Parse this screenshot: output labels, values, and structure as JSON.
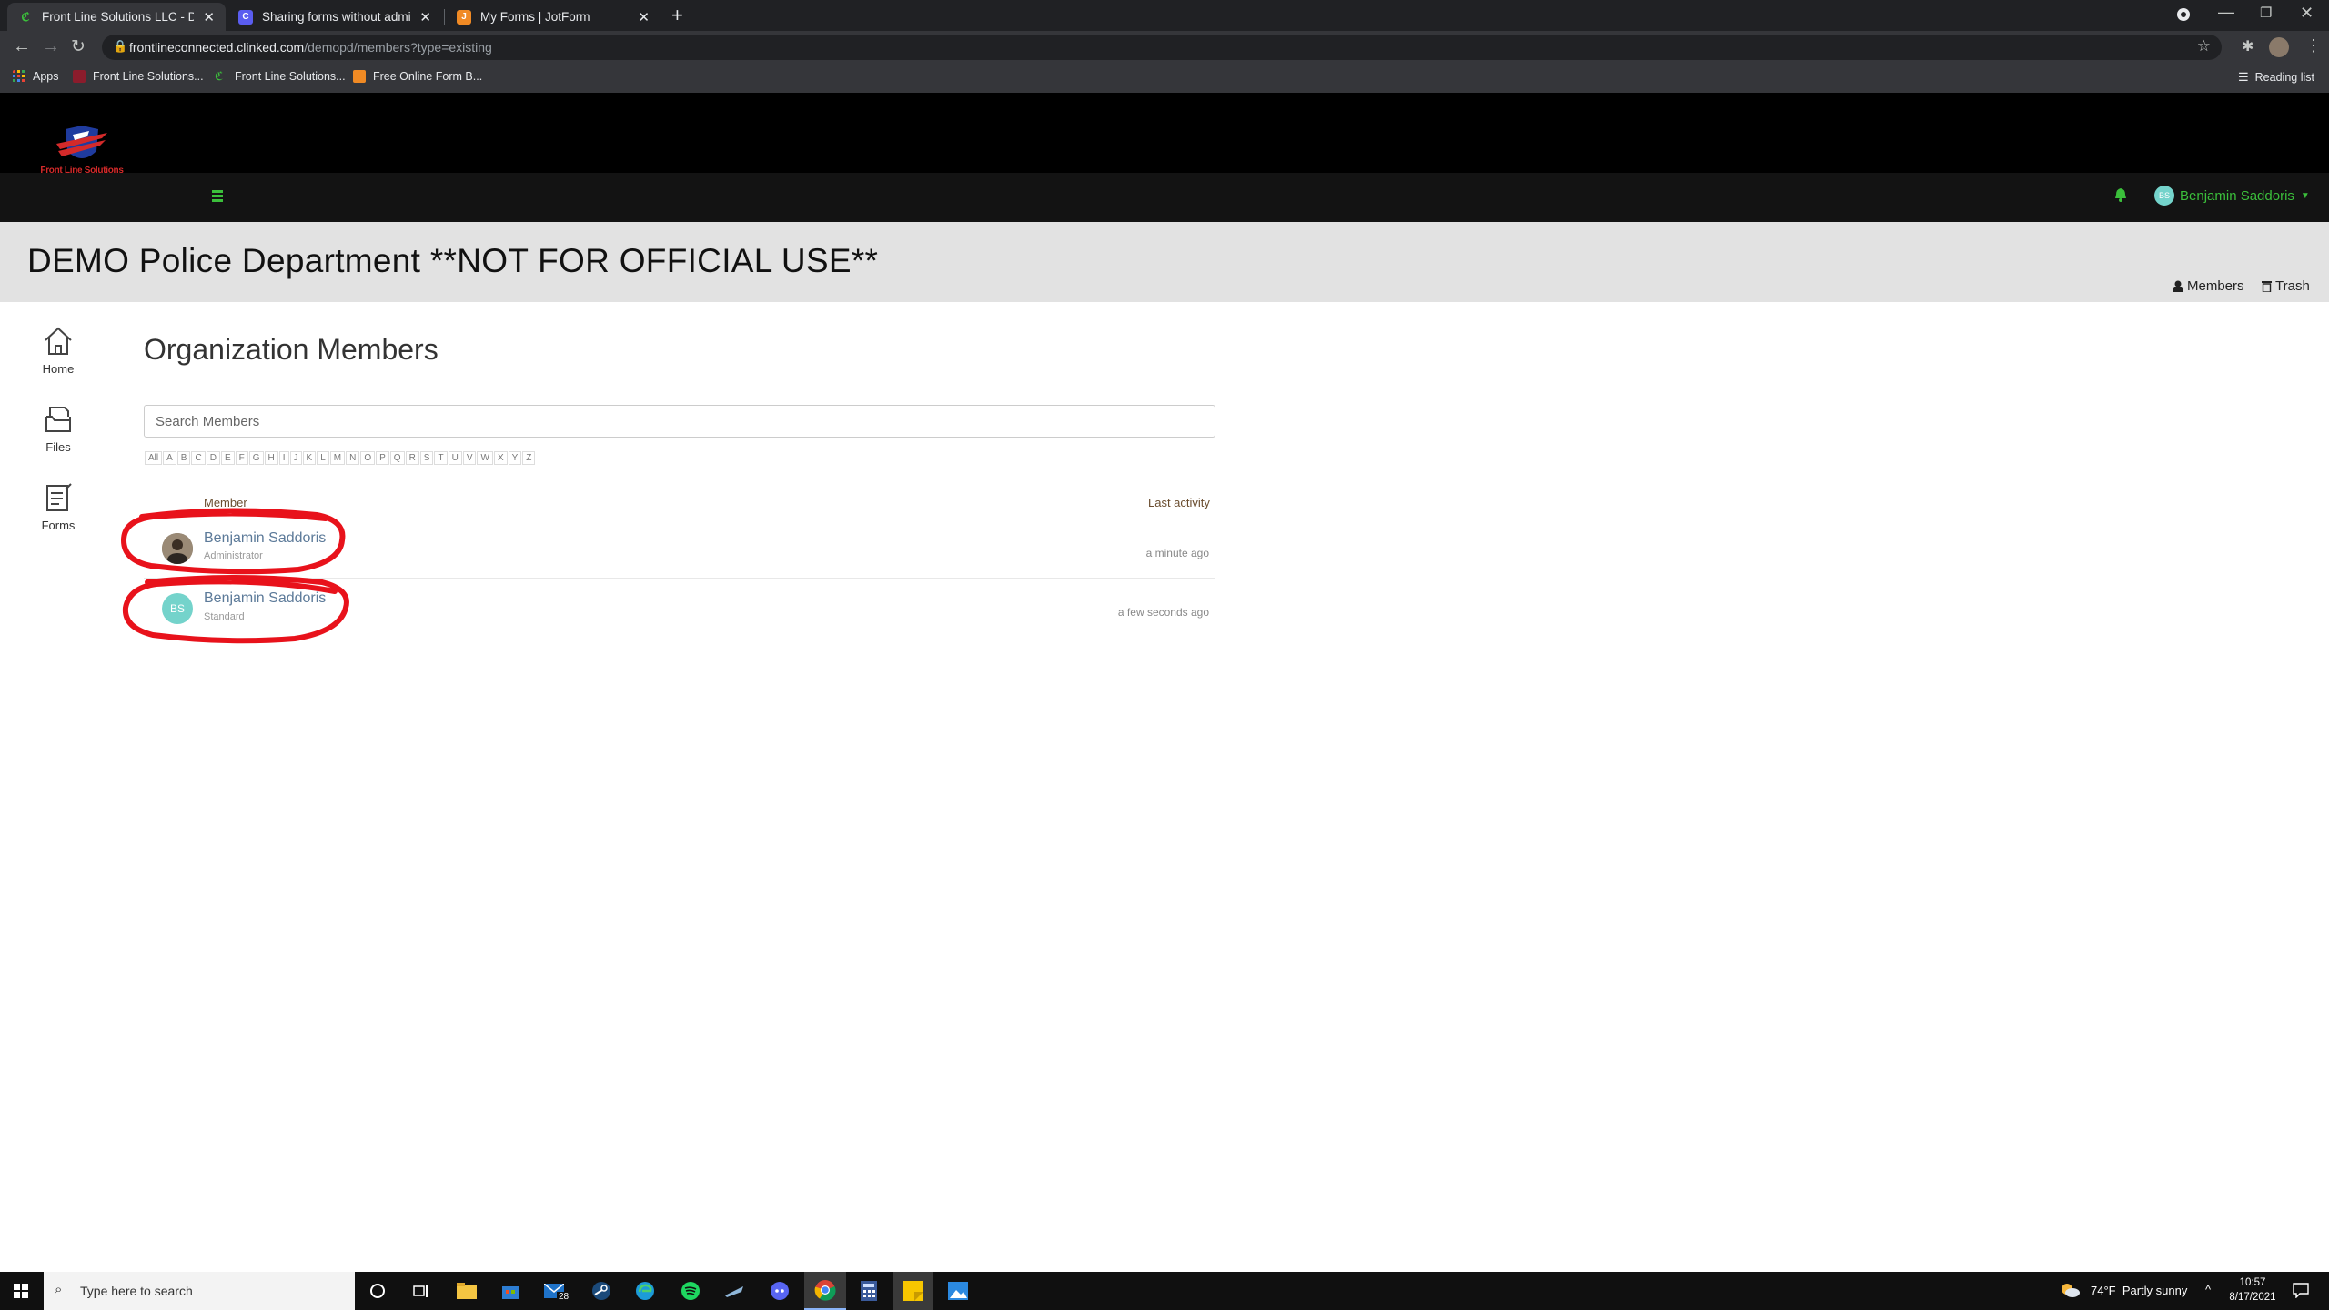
{
  "browser": {
    "tabs": [
      {
        "title": "Front Line Solutions LLC - DEMO",
        "close": "✕"
      },
      {
        "title": "Sharing forms without admin rig",
        "close": "✕"
      },
      {
        "title": "My Forms | JotForm",
        "close": "✕"
      }
    ],
    "new_tab": "+",
    "url_host": "frontlineconnected.clinked.com",
    "url_path": "/demopd/members?type=existing",
    "bookmarks": [
      "Apps",
      "Front Line Solutions...",
      "Front Line Solutions...",
      "Free Online Form B..."
    ],
    "reading_list": "Reading list"
  },
  "site": {
    "logo_text": "Front Line Solutions",
    "user_name": "Benjamin Saddoris",
    "user_initials": "BS",
    "banner_title": "DEMO Police Department **NOT FOR OFFICIAL USE**",
    "members_btn": "Members",
    "trash_btn": "Trash"
  },
  "leftnav": [
    {
      "label": "Home",
      "icon": "home-icon"
    },
    {
      "label": "Files",
      "icon": "files-icon"
    },
    {
      "label": "Forms",
      "icon": "forms-icon"
    }
  ],
  "main": {
    "title": "Organization Members",
    "search_placeholder": "Search Members",
    "letters": [
      "All",
      "A",
      "B",
      "C",
      "D",
      "E",
      "F",
      "G",
      "H",
      "I",
      "J",
      "K",
      "L",
      "M",
      "N",
      "O",
      "P",
      "Q",
      "R",
      "S",
      "T",
      "U",
      "V",
      "W",
      "X",
      "Y",
      "Z"
    ],
    "col_member": "Member",
    "col_activity": "Last activity",
    "members": [
      {
        "name": "Benjamin Saddoris",
        "role": "Administrator",
        "activity": "a minute ago",
        "initials": ""
      },
      {
        "name": "Benjamin Saddoris",
        "role": "Standard",
        "activity": "a few seconds ago",
        "initials": "BS"
      }
    ]
  },
  "taskbar": {
    "search_placeholder": "Type here to search",
    "mail_badge": "28",
    "weather": "74°F  Partly sunny",
    "time": "10:57",
    "date": "8/17/2021"
  },
  "colors": {
    "annotation_red": "#e8121b",
    "user_green": "#3bbf3b",
    "member_link": "#5c7a99"
  }
}
